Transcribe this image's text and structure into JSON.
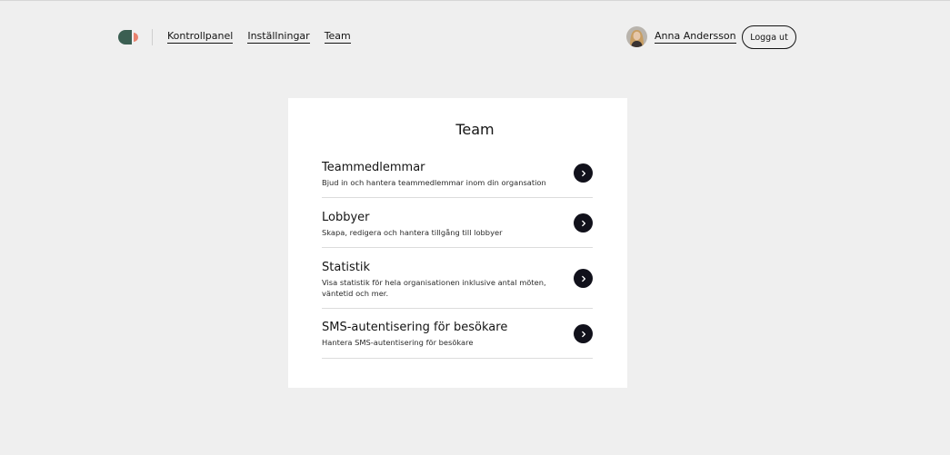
{
  "header": {
    "nav": [
      {
        "label": "Kontrollpanel"
      },
      {
        "label": "Inställningar"
      },
      {
        "label": "Team"
      }
    ],
    "user_name": "Anna Andersson",
    "logout_label": "Logga ut"
  },
  "page": {
    "title": "Team",
    "items": [
      {
        "title": "Teammedlemmar",
        "description": "Bjud in och hantera teammedlemmar inom din organsation"
      },
      {
        "title": "Lobbyer",
        "description": "Skapa, redigera och hantera tillgång till lobbyer"
      },
      {
        "title": "Statistik",
        "description": "Visa statistik för hela organisationen inklusive antal möten, väntetid och mer."
      },
      {
        "title": "SMS-autentisering för besökare",
        "description": "Hantera SMS-autentisering för besökare"
      }
    ]
  },
  "colors": {
    "background": "#efefef",
    "card": "#ffffff",
    "logo_green": "#3b5f52",
    "logo_coral": "#e8826e",
    "arrow_button": "#11111b"
  },
  "icons": {
    "logo": "brand-logo",
    "arrow": "chevron-right-icon"
  }
}
